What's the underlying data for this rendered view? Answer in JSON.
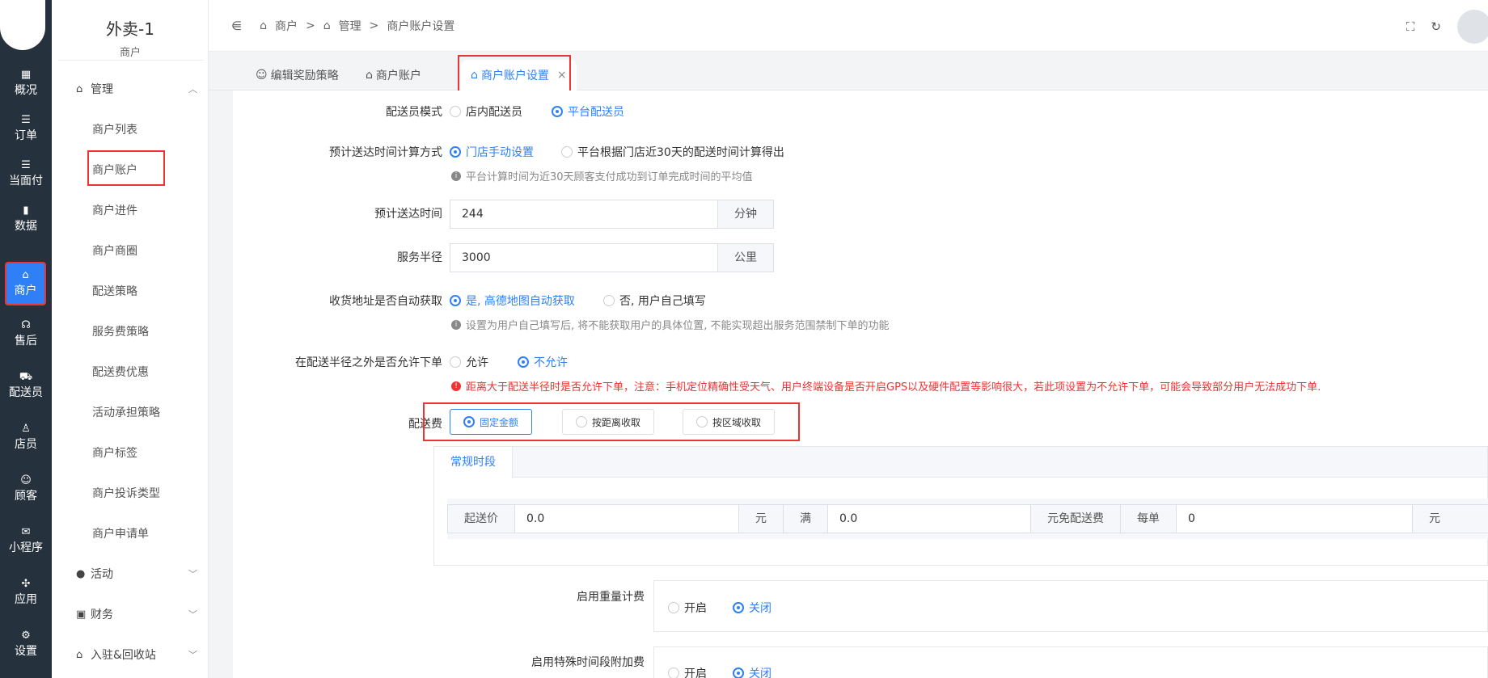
{
  "rail": {
    "items": [
      {
        "glyph": "▦",
        "label": "概况"
      },
      {
        "glyph": "☰",
        "label": "订单"
      },
      {
        "glyph": "☰",
        "label": "当面付"
      },
      {
        "glyph": "▮",
        "label": "数据"
      },
      {
        "glyph": "⌂",
        "label": "商户"
      },
      {
        "glyph": "☊",
        "label": "售后"
      },
      {
        "glyph": "⛟",
        "label": "配送员"
      },
      {
        "glyph": "♙",
        "label": "店员"
      },
      {
        "glyph": "☺",
        "label": "顾客"
      },
      {
        "glyph": "✉",
        "label": "小程序"
      },
      {
        "glyph": "✣",
        "label": "应用"
      },
      {
        "glyph": "⚙",
        "label": "设置"
      }
    ]
  },
  "menu": {
    "brand": "外卖-1",
    "brand_sub": "商户",
    "group_manage": "管理",
    "items": [
      "商户列表",
      "商户账户",
      "商户进件",
      "商户商圈",
      "配送策略",
      "服务费策略",
      "配送费优惠",
      "活动承担策略",
      "商户标签",
      "商户投诉类型",
      "商户申请单"
    ],
    "group_activity": "活动",
    "group_finance": "财务",
    "group_settle": "入驻&回收站"
  },
  "header": {
    "crumb1": "商户",
    "crumb2": "管理",
    "crumb3": "商户账户设置",
    "sep": ">"
  },
  "tabs": {
    "t1": "编辑奖励策略",
    "t2": "商户账户",
    "t3": "商户账户设置",
    "close": "×"
  },
  "form": {
    "courier_mode": {
      "label": "配送员模式",
      "opt1": "店内配送员",
      "opt2": "平台配送员"
    },
    "eta_method": {
      "label": "预计送达时间计算方式",
      "opt1": "门店手动设置",
      "opt2": "平台根据门店近30天的配送时间计算得出",
      "hint": "平台计算时间为近30天顾客支付成功到订单完成时间的平均值"
    },
    "eta": {
      "label": "预计送达时间",
      "value": "244",
      "unit": "分钟"
    },
    "radius": {
      "label": "服务半径",
      "value": "3000",
      "unit": "公里"
    },
    "address_auto": {
      "label": "收货地址是否自动获取",
      "opt1": "是, 高德地图自动获取",
      "opt2": "否, 用户自己填写",
      "hint": "设置为用户自己填写后, 将不能获取用户的具体位置, 不能实现超出服务范围禁制下单的功能"
    },
    "outside_radius": {
      "label": "在配送半径之外是否允许下单",
      "opt1": "允许",
      "opt2": "不允许",
      "warn": "距离大于配送半径时是否允许下单，注意：手机定位精确性受天气、用户终端设备是否开启GPS以及硬件配置等影响很大，若此项设置为不允许下单，可能会导致部分用户无法成功下单."
    },
    "fee": {
      "label": "配送费",
      "opt1": "固定金额",
      "opt2": "按距离收取",
      "opt3": "按区域收取"
    },
    "period": {
      "tab": "常规时段",
      "min_label": "起送价",
      "min_value": "0.0",
      "yuan": "元",
      "full": "满",
      "full_value": "0.0",
      "free_label": "元免配送费",
      "each": "每单",
      "each_value": "0",
      "yuan2": "元"
    },
    "weight": {
      "label": "启用重量计费",
      "on": "开启",
      "off": "关闭"
    },
    "special": {
      "label": "启用特殊时间段附加费",
      "on": "开启",
      "off": "关闭"
    }
  }
}
